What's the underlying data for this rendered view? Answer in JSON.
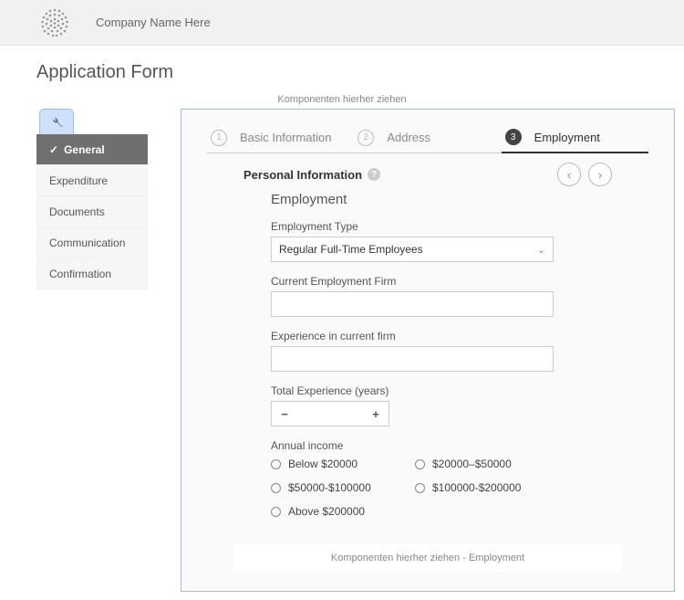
{
  "header": {
    "company_name": "Company Name Here"
  },
  "page_title": "Application Form",
  "helper_text_top": "Komponenten hierher ziehen",
  "sidebar": {
    "items": [
      {
        "label": "General",
        "active": true
      },
      {
        "label": "Expenditure",
        "active": false
      },
      {
        "label": "Documents",
        "active": false
      },
      {
        "label": "Communication",
        "active": false
      },
      {
        "label": "Confirmation",
        "active": false
      }
    ]
  },
  "steps": [
    {
      "num": "1",
      "label": "Basic Information",
      "active": false
    },
    {
      "num": "2",
      "label": "Address",
      "active": false
    },
    {
      "num": "3",
      "label": "Employment",
      "active": true
    }
  ],
  "section": {
    "title": "Personal Information",
    "sub_title": "Employment",
    "fields": {
      "employment_type_label": "Employment Type",
      "employment_type_value": "Regular Full-Time Employees",
      "current_firm_label": "Current Employment Firm",
      "current_firm_value": "",
      "experience_firm_label": "Experience in current firm",
      "experience_firm_value": "",
      "total_exp_label": "Total Experience (years)",
      "total_exp_value": "",
      "annual_income_label": "Annual income",
      "income_options": [
        "Below $20000",
        "$20000–$50000",
        "$50000-$100000",
        "$100000-$200000",
        "Above $200000"
      ]
    },
    "dropzone_text": "Komponenten hierher ziehen - Employment"
  }
}
